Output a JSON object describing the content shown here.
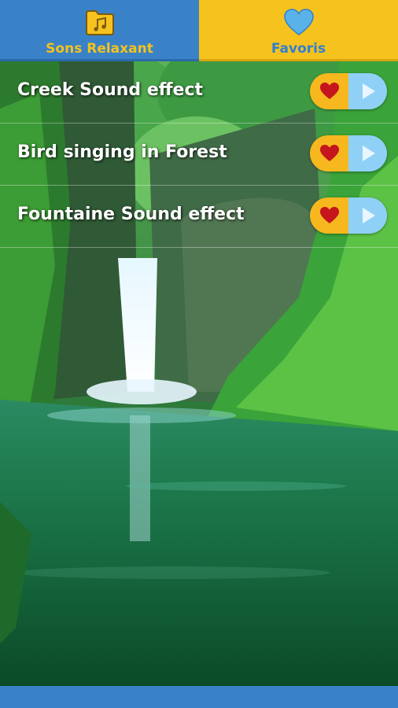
{
  "tabs": [
    {
      "label": "Sons Relaxant",
      "icon": "music-folder-icon",
      "active": false,
      "color": "#3a82c8"
    },
    {
      "label": "Favoris",
      "icon": "heart-icon",
      "active": true,
      "color": "#f6c21d"
    }
  ],
  "sounds": [
    {
      "title": "Creek Sound effect",
      "favorite_icon": "heart-icon",
      "play_icon": "play-icon"
    },
    {
      "title": "Bird singing in Forest",
      "favorite_icon": "heart-icon",
      "play_icon": "play-icon"
    },
    {
      "title": "Fountaine Sound effect",
      "favorite_icon": "heart-icon",
      "play_icon": "play-icon"
    }
  ],
  "background": {
    "description_icon": "waterfall-forest-image"
  },
  "colors": {
    "accent_blue": "#3a82c8",
    "accent_yellow": "#f6c21d",
    "heart_red": "#c4161c",
    "play_blue": "#8fd0f6"
  }
}
